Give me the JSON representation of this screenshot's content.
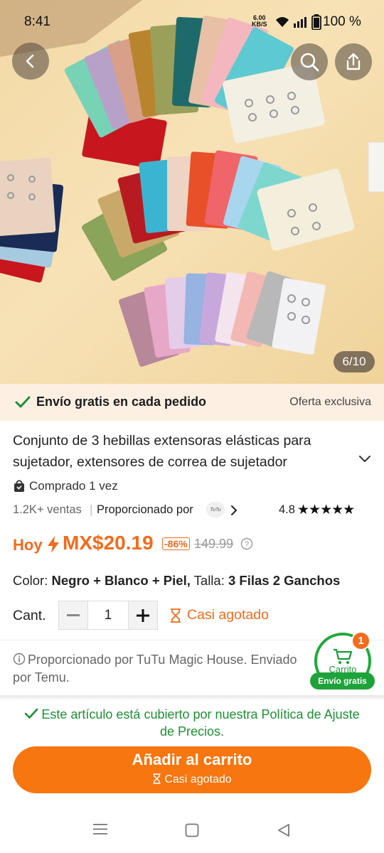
{
  "status": {
    "time": "8:41",
    "speed_top": "6.00",
    "speed_bottom": "KB/S",
    "battery": "100 %"
  },
  "hero": {
    "image_counter": "6/10"
  },
  "shipping": {
    "text": "Envío gratis en cada pedido",
    "offer": "Oferta exclusiva"
  },
  "product": {
    "title": "Conjunto de 3 hebillas extensoras elásticas para sujetador, extensores de correa de sujetador",
    "bought": "Comprado 1 vez",
    "sales": "1.2K+ ventas",
    "separator": "|",
    "provided_by": "Proporcionado por",
    "store_logo_text": "TuTu",
    "rating": "4.8",
    "stars": "★★★★★"
  },
  "price": {
    "today_label": "Hoy",
    "current": "MX$20.19",
    "discount": "-86%",
    "original": "149.99"
  },
  "variant": {
    "color_label": "Color:",
    "color_value": "Negro + Blanco + Piel,",
    "size_label": "Talla:",
    "size_value": "3 Filas 2 Ganchos"
  },
  "quantity": {
    "label": "Cant.",
    "value": "1",
    "stock_status": "Casi agotado"
  },
  "note": {
    "text": "Proporcionado por TuTu Magic House. Enviado por Temu."
  },
  "cart": {
    "label": "Carrito",
    "badge": "1",
    "free_shipping": "Envío gratis"
  },
  "policy": {
    "text": "Este artículo está cubierto por nuestra Política de Ajuste de Precios."
  },
  "cta": {
    "main": "Añadir al carrito",
    "sub": "Casi agotado"
  },
  "colors": {
    "accent_orange": "#f26b1c",
    "button_orange": "#f7760f",
    "green": "#1ea33a",
    "banner_bg": "#fdf0e3"
  },
  "icons": [
    "back-arrow-icon",
    "search-icon",
    "share-icon",
    "check-icon",
    "chevron-down-icon",
    "bag-icon",
    "chevron-right-icon",
    "star-icon",
    "bolt-icon",
    "info-icon",
    "minus-icon",
    "plus-icon",
    "hourglass-icon",
    "cart-icon",
    "menu-icon",
    "home-icon",
    "back-triangle-icon"
  ]
}
